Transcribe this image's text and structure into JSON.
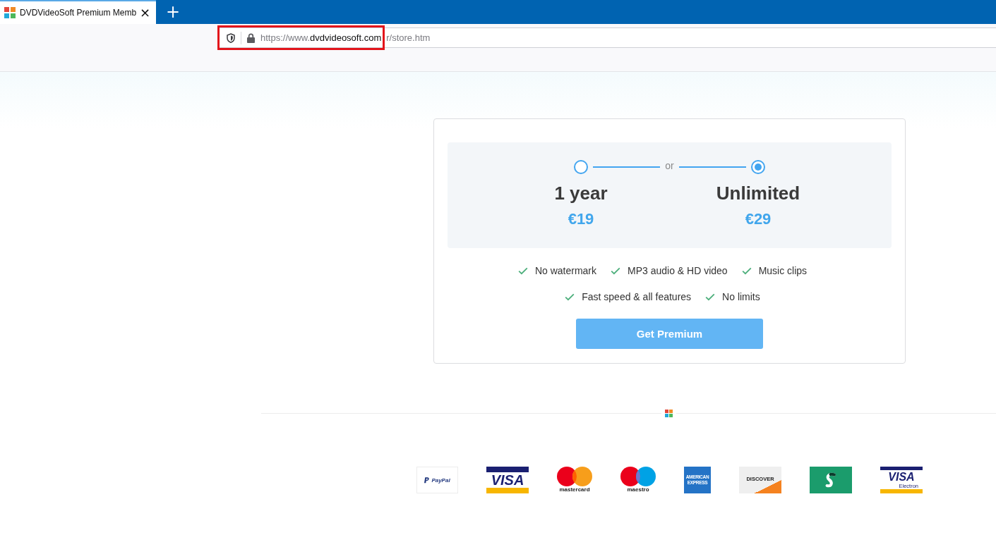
{
  "browser": {
    "tab": {
      "title": "DVDVideoSoft Premium Memb",
      "close": "×",
      "selected": true
    },
    "new_tab": "+",
    "address": {
      "scheme": "https://www.",
      "domain": "dvdvideosoft.com",
      "path": "r/store.htm"
    }
  },
  "plans": [
    {
      "name": "1 year",
      "price": "€19",
      "selected": false
    },
    {
      "name": "Unlimited",
      "price": "€29",
      "selected": true
    }
  ],
  "separator": "or",
  "features": [
    [
      "No watermark",
      "MP3 audio & HD video",
      "Music clips"
    ],
    [
      "Fast speed & all features",
      "No limits"
    ]
  ],
  "button": "Get Premium",
  "payment_methods": [
    {
      "kind": "paypal",
      "text": "PayPal"
    },
    {
      "kind": "visa",
      "text": "VISA"
    },
    {
      "kind": "mastercard",
      "text": "mastercard"
    },
    {
      "kind": "maestro",
      "text": "maestro"
    },
    {
      "kind": "amex",
      "text": "AMERICAN EXPRESS"
    },
    {
      "kind": "discover",
      "text": "DISCOVER"
    },
    {
      "kind": "swirl"
    },
    {
      "kind": "electron",
      "text": "VISA",
      "subtext": "Electron"
    }
  ]
}
